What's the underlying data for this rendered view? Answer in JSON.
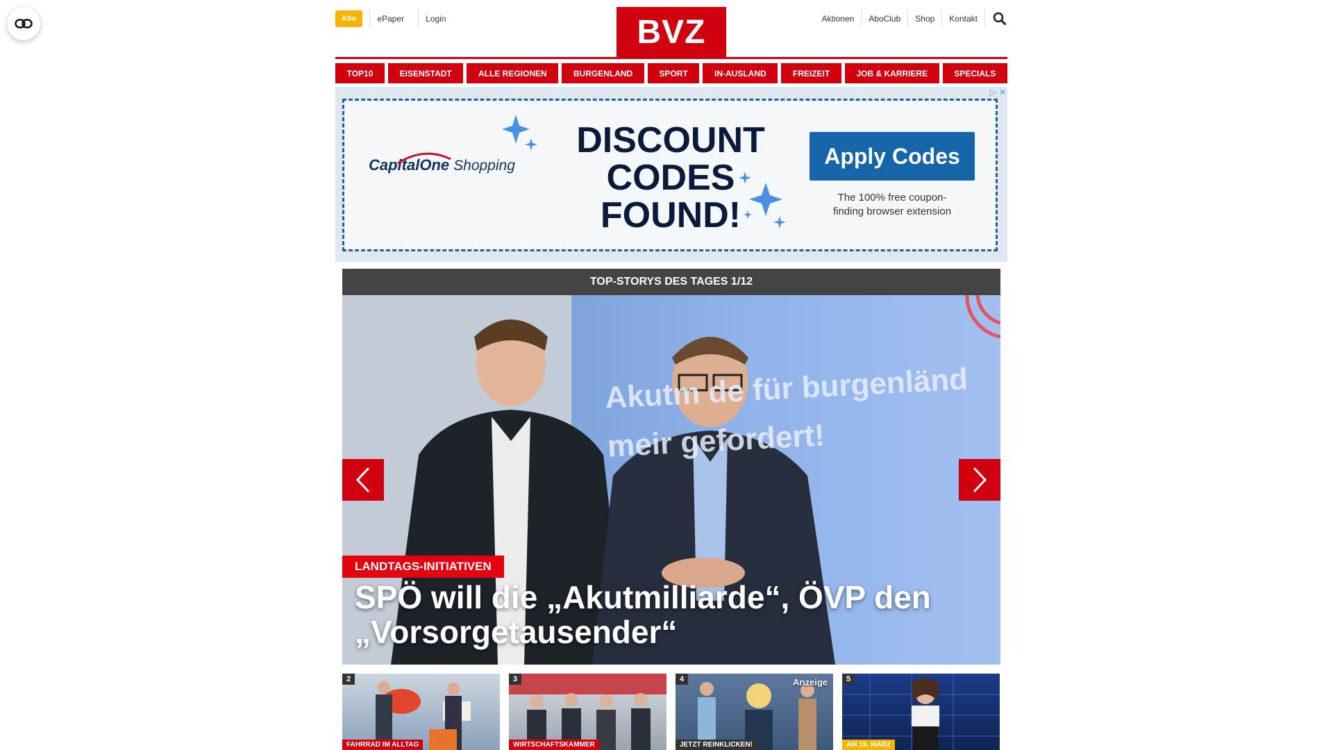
{
  "header": {
    "abo": "Abo",
    "left_links": [
      "ePaper",
      "Login"
    ],
    "logo": "BVZ",
    "right_links": [
      "Aktionen",
      "AboClub",
      "Shop",
      "Kontakt"
    ]
  },
  "nav": [
    "TOP10",
    "EISENSTADT",
    "ALLE REGIONEN",
    "BURGENLAND",
    "SPORT",
    "IN-AUSLAND",
    "FREIZEIT",
    "JOB & KARRIERE",
    "SPECIALS"
  ],
  "ad": {
    "brand": "CapitalOne",
    "brand_sub": "Shopping",
    "headline_lines": [
      "DISCOUNT",
      "CODES",
      "FOUND!"
    ],
    "cta": "Apply Codes",
    "sub_lines": [
      "The 100% free coupon-",
      "finding browser extension"
    ]
  },
  "slider": {
    "header": "TOP-STORYS DES TAGES 1/12",
    "image_text_lines": [
      "Akutm de für burgenländ",
      "meir geforde­rt!"
    ],
    "kicker": "LANDTAGS-INITIATIVEN",
    "headline_lines": [
      "SPÖ will die „Akutmilliarde“, ÖVP den",
      "„Vorsorgetausender“"
    ]
  },
  "thumbs": [
    {
      "num": "2",
      "tag": "FAHRRAD IM ALLTAG",
      "tag_color": "#d0000f"
    },
    {
      "num": "3",
      "tag": "WIRTSCHAFTSKAMMER",
      "tag_color": "#d0000f"
    },
    {
      "num": "4",
      "tag": "JETZT REINKLICKEN!",
      "tag_color": "#333333",
      "badge": "Anzeige"
    },
    {
      "num": "5",
      "tag": "AM 19. MÄRZ",
      "tag_color": "#f5b400"
    }
  ],
  "colors": {
    "brand_red": "#d0000f",
    "abo_yellow": "#f5b400",
    "cta_blue": "#1565a8"
  }
}
